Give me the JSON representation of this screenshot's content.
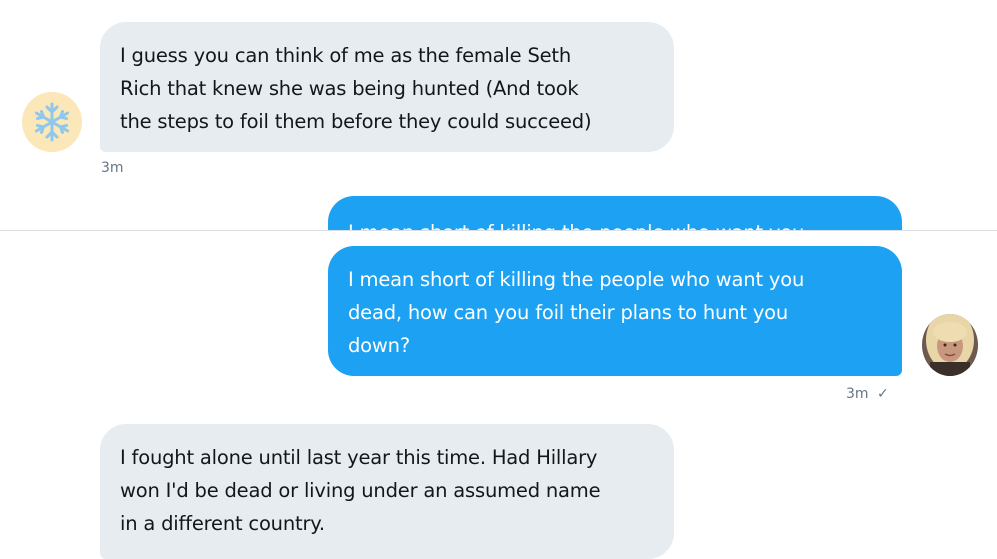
{
  "messages": [
    {
      "direction": "received",
      "lines": [
        "I guess you can think of me as the female Seth",
        "Rich that knew she was being hunted (And took",
        "the steps to foil them before they could succeed)"
      ],
      "time": "3m",
      "avatar_icon": "snowflake-icon"
    },
    {
      "direction": "sent",
      "lines": [
        "I mean short of killing the people who want you",
        "dead, how can you foil their plans to hunt you",
        "down?"
      ],
      "time": "3m",
      "read_mark": "✓",
      "avatar_icon": "user-photo"
    },
    {
      "direction": "received",
      "lines": [
        "I fought alone until last year this time.  Had Hillary",
        "won I'd be dead or living under an assumed name",
        "in a different country."
      ]
    }
  ],
  "colors": {
    "sent_bubble": "#1da1f2",
    "received_bubble": "#e6ecf0",
    "meta_text": "#657786"
  }
}
